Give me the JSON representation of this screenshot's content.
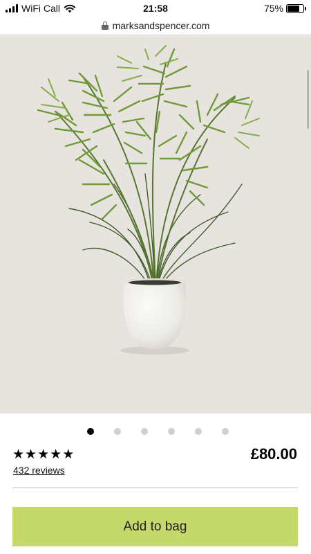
{
  "status_bar": {
    "carrier": "WiFi Call",
    "time": "21:58",
    "battery_percent": "75%",
    "battery_level": 0.75
  },
  "browser": {
    "url": "marksandspencer.com"
  },
  "product": {
    "image_icon": "artificial-palm-plant-in-white-pot",
    "carousel_total": 6,
    "carousel_active": 1,
    "rating_stars": 5,
    "reviews_label": "432 reviews",
    "price": "£80.00",
    "add_to_bag_label": "Add to bag"
  },
  "colors": {
    "image_background": "#e7e3de",
    "add_to_bag": "#c4d96a"
  }
}
